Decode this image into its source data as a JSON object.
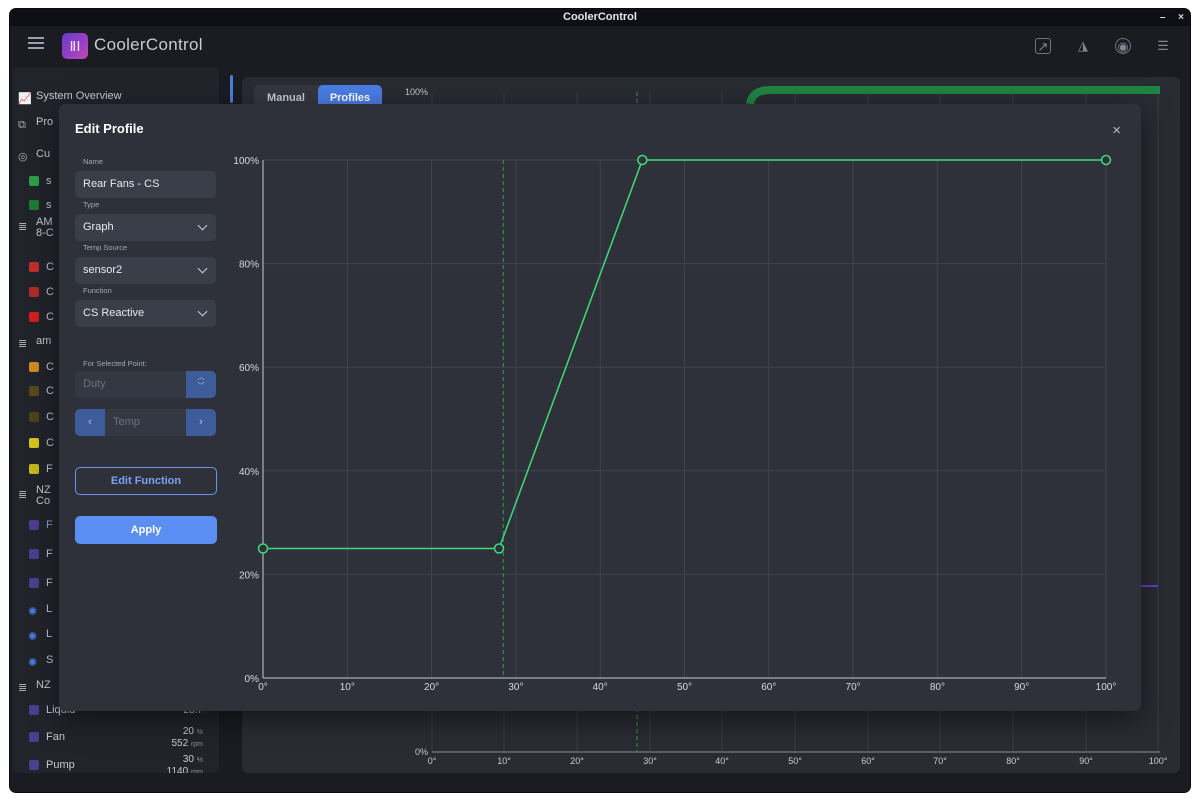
{
  "window": {
    "title": "CoolerControl",
    "controls": [
      "–",
      "×"
    ]
  },
  "app": {
    "name": "CoolerControl",
    "logo_glyph": "ⅡⅠ"
  },
  "toolbar": {
    "icons": [
      "open-external-icon",
      "gitlab-icon",
      "shield-icon",
      "sliders-icon"
    ]
  },
  "sidebar": {
    "top_items": [
      {
        "label": "System Overview",
        "icon": "chart-line-icon"
      },
      {
        "label": "Pro",
        "icon": "profiles-icon"
      }
    ],
    "sections": [
      {
        "label": "Cu",
        "icon": "custom-sensor-icon"
      },
      {
        "label": "AM 8-C",
        "icon": "cpu-icon"
      },
      {
        "label": "am",
        "icon": "gpu-icon"
      },
      {
        "label": "NZ Co",
        "icon": "device-icon"
      },
      {
        "label": "NZ",
        "icon": "device-icon"
      }
    ],
    "rows": [
      {
        "label": "s",
        "color": "#2e9e4a"
      },
      {
        "label": "s",
        "color": "#1f7a36"
      },
      {
        "label": "C",
        "color": "#c0302c"
      },
      {
        "label": "C",
        "color": "#b02a28"
      },
      {
        "label": "C",
        "color": "#d0201c"
      },
      {
        "label": "C",
        "color": "#d08b24"
      },
      {
        "label": "C",
        "color": "#5a4a1a"
      },
      {
        "label": "C",
        "color": "#4d4418"
      },
      {
        "label": "C",
        "color": "#d4c51e"
      },
      {
        "label": "F",
        "color": "#c9b81c"
      },
      {
        "label": "F",
        "color": "#4b3f8f"
      },
      {
        "label": "F",
        "color": "#4b3f8f"
      },
      {
        "label": "F",
        "color": "#4b3f8f"
      },
      {
        "label": "L",
        "color": "#4a7ee6"
      },
      {
        "label": "L",
        "color": "#4a7ee6"
      },
      {
        "label": "S",
        "color": "#4a7ee6"
      }
    ],
    "bottom_rows": [
      {
        "label": "Liquid",
        "value": "28.7",
        "color": "#4b3f8f"
      },
      {
        "label": "Fan",
        "duty": "20",
        "duty_unit": "%",
        "rpm": "552",
        "rpm_unit": "rpm",
        "color": "#4b3f8f"
      },
      {
        "label": "Pump",
        "duty": "30",
        "duty_unit": "%",
        "rpm": "1140",
        "rpm_unit": "rpm",
        "color": "#4b3f8f"
      }
    ]
  },
  "background": {
    "tabs": [
      "Manual",
      "Profiles"
    ],
    "active_tab": "Profiles",
    "y_top_label": "100%",
    "y_bottom_label": "0%",
    "x_ticks": [
      "0°",
      "10°",
      "20°",
      "30°",
      "40°",
      "50°",
      "60°",
      "70°",
      "80°",
      "90°",
      "100°"
    ]
  },
  "modal": {
    "title": "Edit Profile",
    "close_label": "×",
    "name_label": "Name",
    "name_value": "Rear Fans - CS",
    "type_label": "Type",
    "type_value": "Graph",
    "temp_source_label": "Temp Source",
    "temp_source_value": "sensor2",
    "function_label": "Function",
    "function_value": "CS Reactive",
    "selected_point_label": "For Selected Point:",
    "duty_placeholder": "Duty",
    "temp_placeholder": "Temp",
    "edit_function_label": "Edit Function",
    "apply_label": "Apply"
  },
  "chart_data": {
    "type": "line",
    "title": "",
    "xlabel": "",
    "ylabel": "",
    "xlim": [
      0,
      100
    ],
    "ylim": [
      0,
      100
    ],
    "x_ticks": [
      0,
      10,
      20,
      30,
      40,
      50,
      60,
      70,
      80,
      90,
      100
    ],
    "x_tick_labels": [
      "0°",
      "10°",
      "20°",
      "30°",
      "40°",
      "50°",
      "60°",
      "70°",
      "80°",
      "90°",
      "100°"
    ],
    "y_ticks": [
      0,
      20,
      40,
      60,
      80,
      100
    ],
    "y_tick_labels": [
      "0%",
      "20%",
      "40%",
      "60%",
      "80%",
      "100%"
    ],
    "grid": true,
    "current_temp_marker": 28.5,
    "series": [
      {
        "x": [
          0,
          28,
          45,
          100
        ],
        "y": [
          25,
          25,
          100,
          100
        ],
        "color": "#3ddc7a"
      }
    ]
  }
}
